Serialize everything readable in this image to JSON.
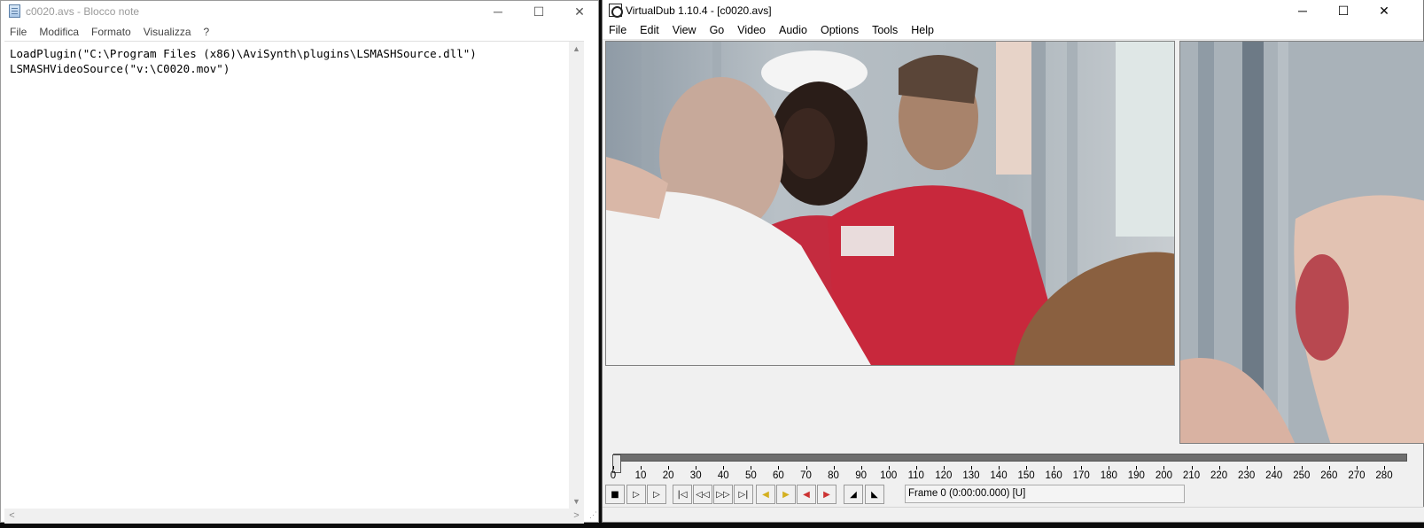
{
  "notepad": {
    "title": "c0020.avs - Blocco note",
    "caption_buttons": {
      "minimize": "─",
      "maximize": "☐",
      "close": "✕"
    },
    "menu": [
      "File",
      "Modifica",
      "Formato",
      "Visualizza",
      "?"
    ],
    "lines": [
      "LoadPlugin(\"C:\\Program Files (x86)\\AviSynth\\plugins\\LSMASHSource.dll\")",
      "LSMASHVideoSource(\"v:\\C0020.mov\")"
    ],
    "scroll_glyphs": {
      "up": "▲",
      "down": "▼",
      "left": "<",
      "right": ">",
      "grip": "⋰"
    }
  },
  "virtualdub": {
    "title": "VirtualDub 1.10.4 - [c0020.avs]",
    "caption_buttons": {
      "minimize": "─",
      "maximize": "☐",
      "close": "✕"
    },
    "menu": [
      "File",
      "Edit",
      "View",
      "Go",
      "Video",
      "Audio",
      "Options",
      "Tools",
      "Help"
    ],
    "timeline": {
      "min": 0,
      "max": 280,
      "current_frame": 0,
      "labels": [
        "0",
        "10",
        "20",
        "30",
        "40",
        "50",
        "60",
        "70",
        "80",
        "90",
        "100",
        "110",
        "120",
        "130",
        "140",
        "150",
        "160",
        "170",
        "180",
        "190",
        "200",
        "210",
        "220",
        "230",
        "240",
        "250",
        "260",
        "270",
        "280"
      ]
    },
    "toolbar": [
      {
        "name": "stop-button",
        "glyph": "■",
        "icon": "stop-icon"
      },
      {
        "name": "play-input-button",
        "glyph": "▷",
        "icon": "play-input-icon"
      },
      {
        "name": "play-output-button",
        "glyph": "▷",
        "icon": "play-output-icon"
      },
      {
        "name": "go-start-button",
        "glyph": "|◁",
        "icon": "go-start-icon"
      },
      {
        "name": "prev-frame-button",
        "glyph": "◁◁",
        "icon": "prev-frame-icon"
      },
      {
        "name": "next-frame-button",
        "glyph": "▷▷",
        "icon": "next-frame-icon"
      },
      {
        "name": "go-end-button",
        "glyph": "▷|",
        "icon": "go-end-icon"
      },
      {
        "name": "prev-keyframe-button",
        "glyph": "◀",
        "icon": "prev-keyframe-icon"
      },
      {
        "name": "next-keyframe-button",
        "glyph": "▶",
        "icon": "next-keyframe-icon"
      },
      {
        "name": "prev-scene-button",
        "glyph": "◀",
        "icon": "prev-scene-icon"
      },
      {
        "name": "next-scene-button",
        "glyph": "▶",
        "icon": "next-scene-icon"
      },
      {
        "name": "mark-in-button",
        "glyph": "◢",
        "icon": "mark-in-icon"
      },
      {
        "name": "mark-out-button",
        "glyph": "◣",
        "icon": "mark-out-icon"
      }
    ],
    "frame_status": "Frame 0 (0:00:00.000) [U]",
    "colors": {
      "track": "#6e6e6e",
      "shirt_red": "#c8283c",
      "keyframe_yellow": "#e0c020"
    }
  }
}
